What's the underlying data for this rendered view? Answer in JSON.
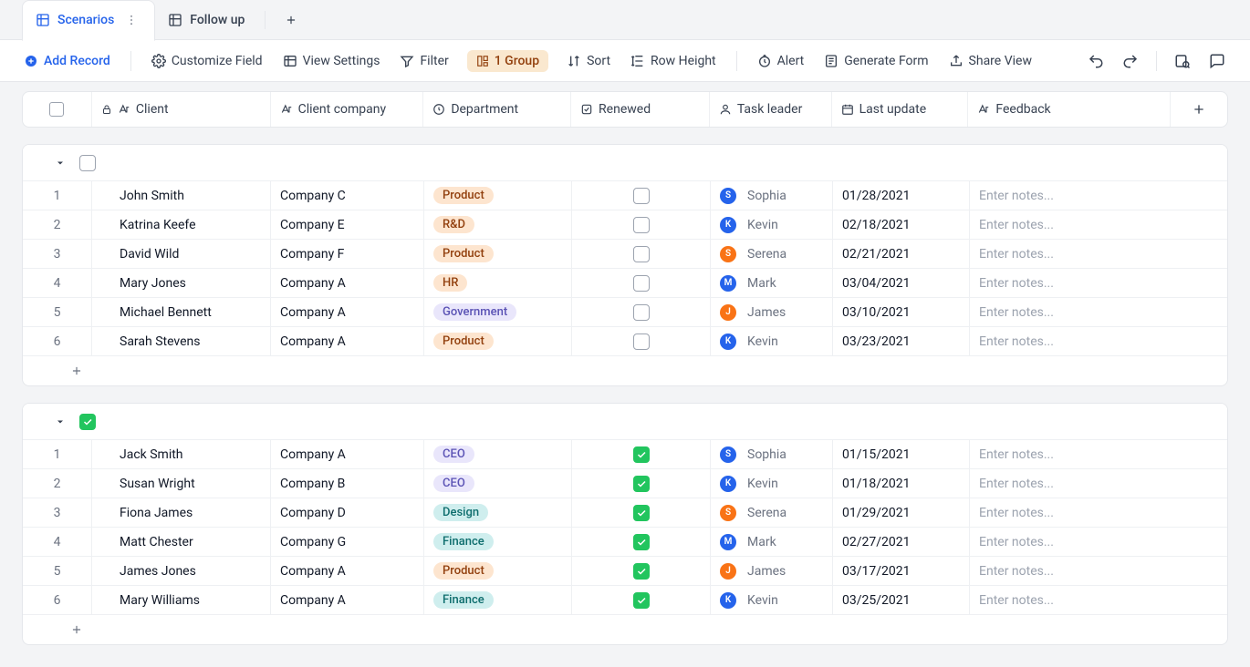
{
  "tabs": {
    "items": [
      {
        "label": "Scenarios",
        "active": true
      },
      {
        "label": "Follow up",
        "active": false
      }
    ]
  },
  "toolbar": {
    "add_record": "Add Record",
    "customize_field": "Customize Field",
    "view_settings": "View Settings",
    "filter": "Filter",
    "group_chip": "1 Group",
    "sort": "Sort",
    "row_height": "Row Height",
    "alert": "Alert",
    "generate_form": "Generate Form",
    "share_view": "Share View"
  },
  "columns": {
    "client": "Client",
    "company": "Client company",
    "department": "Department",
    "renewed": "Renewed",
    "leader": "Task leader",
    "update": "Last update",
    "feedback": "Feedback"
  },
  "feedback_placeholder": "Enter notes...",
  "departments": {
    "Product": {
      "bg": "#fde5cf",
      "tx": "#92400e"
    },
    "R&D": {
      "bg": "#fde5cf",
      "tx": "#92400e"
    },
    "HR": {
      "bg": "#fde5cf",
      "tx": "#92400e"
    },
    "Government": {
      "bg": "#e9e6fb",
      "tx": "#5b53b5"
    },
    "CEO": {
      "bg": "#e9e6fb",
      "tx": "#5b53b5"
    },
    "Design": {
      "bg": "#cfeeee",
      "tx": "#0f6e6e"
    },
    "Finance": {
      "bg": "#cfeeee",
      "tx": "#0f6e6e"
    }
  },
  "leaders": {
    "Sophia": {
      "color": "#2563eb",
      "initial": "S"
    },
    "Kevin": {
      "color": "#2563eb",
      "initial": "K"
    },
    "Serena": {
      "color": "#f97316",
      "initial": "S"
    },
    "Mark": {
      "color": "#2563eb",
      "initial": "M"
    },
    "James": {
      "color": "#f97316",
      "initial": "J"
    }
  },
  "groups": [
    {
      "checked": false,
      "rows": [
        {
          "client": "John Smith",
          "company": "Company C",
          "department": "Product",
          "renewed": false,
          "leader": "Sophia",
          "update": "01/28/2021"
        },
        {
          "client": "Katrina Keefe",
          "company": "Company E",
          "department": "R&D",
          "renewed": false,
          "leader": "Kevin",
          "update": "02/18/2021"
        },
        {
          "client": "David Wild",
          "company": "Company F",
          "department": "Product",
          "renewed": false,
          "leader": "Serena",
          "update": "02/21/2021"
        },
        {
          "client": "Mary Jones",
          "company": "Company A",
          "department": "HR",
          "renewed": false,
          "leader": "Mark",
          "update": "03/04/2021"
        },
        {
          "client": "Michael Bennett",
          "company": "Company A",
          "department": "Government",
          "renewed": false,
          "leader": "James",
          "update": "03/10/2021"
        },
        {
          "client": "Sarah Stevens",
          "company": "Company A",
          "department": "Product",
          "renewed": false,
          "leader": "Kevin",
          "update": "03/23/2021"
        }
      ]
    },
    {
      "checked": true,
      "rows": [
        {
          "client": "Jack Smith",
          "company": "Company A",
          "department": "CEO",
          "renewed": true,
          "leader": "Sophia",
          "update": "01/15/2021"
        },
        {
          "client": "Susan Wright",
          "company": "Company B",
          "department": "CEO",
          "renewed": true,
          "leader": "Kevin",
          "update": "01/18/2021"
        },
        {
          "client": "Fiona James",
          "company": "Company D",
          "department": "Design",
          "renewed": true,
          "leader": "Serena",
          "update": "01/29/2021"
        },
        {
          "client": "Matt Chester",
          "company": "Company G",
          "department": "Finance",
          "renewed": true,
          "leader": "Mark",
          "update": "02/27/2021"
        },
        {
          "client": "James Jones",
          "company": "Company A",
          "department": "Product",
          "renewed": true,
          "leader": "James",
          "update": "03/17/2021"
        },
        {
          "client": "Mary Williams",
          "company": "Company A",
          "department": "Finance",
          "renewed": true,
          "leader": "Kevin",
          "update": "03/25/2021"
        }
      ]
    }
  ]
}
